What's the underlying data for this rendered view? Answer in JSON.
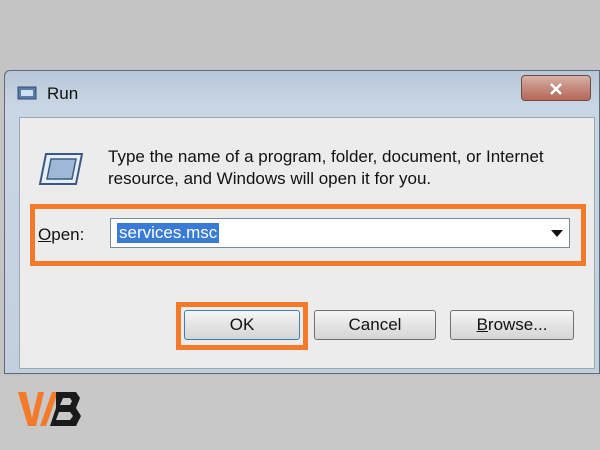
{
  "window": {
    "title": "Run",
    "icons": {
      "title": "run-app-icon",
      "close": "close-icon",
      "main": "run-icon"
    }
  },
  "dialog": {
    "description": "Type the name of a program, folder, document, or Internet resource, and Windows will open it for you.",
    "open_label_prefix": "O",
    "open_label_rest": "pen:",
    "open_value": "services.msc"
  },
  "buttons": {
    "ok": "OK",
    "cancel": "Cancel",
    "browse_prefix": "B",
    "browse_rest": "rowse..."
  },
  "colors": {
    "highlight": "#f47a2a",
    "selection": "#3a7bd5",
    "close_button": "#c48a7e"
  }
}
